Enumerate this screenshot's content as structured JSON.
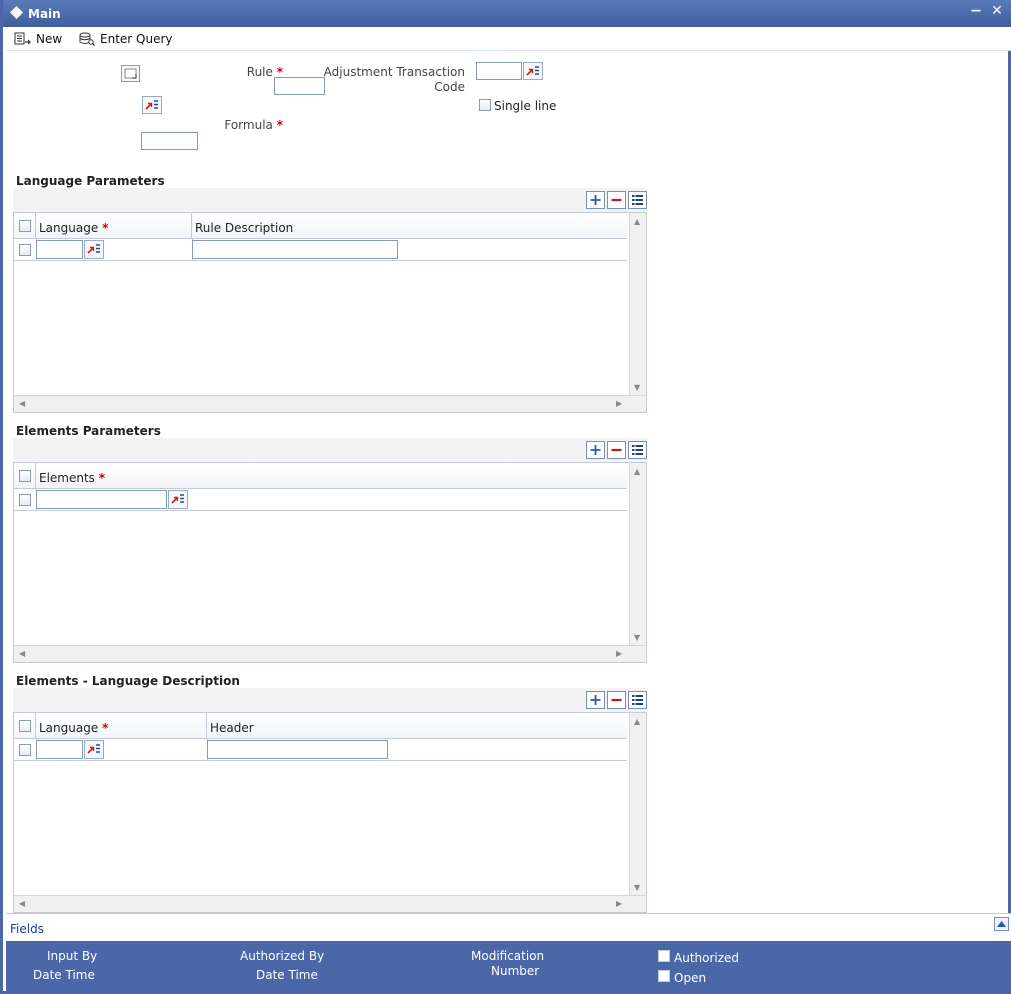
{
  "window": {
    "title": "Main",
    "minimize_glyph": "−",
    "close_glyph": "✕"
  },
  "toolbar": {
    "new_label": "New",
    "enter_query_label": "Enter Query"
  },
  "header_form": {
    "rule_label": "Rule",
    "rule_value": "",
    "formula_label": "Formula",
    "formula_value": "",
    "adjustment_label_line1": "Adjustment Transaction",
    "adjustment_label_line2": "Code",
    "adjustment_value": "",
    "single_line_label": "Single line",
    "required_mark": "*"
  },
  "language_parameters": {
    "title": "Language Parameters",
    "columns": [
      "Language",
      "Rule Description"
    ],
    "rows": [
      {
        "language": "",
        "rule_description": ""
      }
    ]
  },
  "elements_parameters": {
    "title": "Elements Parameters",
    "columns": [
      "Elements"
    ],
    "rows": [
      {
        "elements": ""
      }
    ]
  },
  "elements_language_description": {
    "title": "Elements - Language Description",
    "columns": [
      "Language",
      "Header"
    ],
    "rows": [
      {
        "language": "",
        "header": ""
      }
    ]
  },
  "fields_bar": {
    "label": "Fields"
  },
  "audit": {
    "input_by": "Input By",
    "date_time_1": "Date Time",
    "authorized_by": "Authorized By",
    "date_time_2": "Date Time",
    "modification": "Modification",
    "number": "Number",
    "authorized": "Authorized",
    "open": "Open"
  },
  "colors": {
    "titlebar": "#4a68a8",
    "required": "#c80000",
    "link": "#1a3c9c"
  }
}
